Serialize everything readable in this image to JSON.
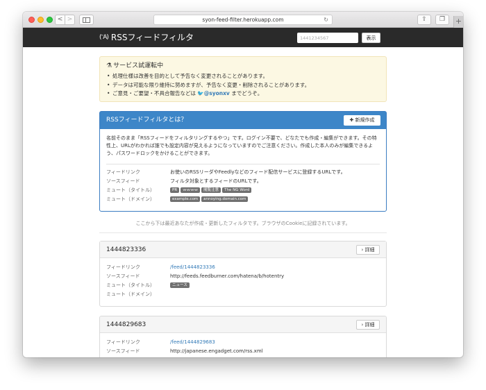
{
  "browser": {
    "url": "syon-feed-filter.herokuapp.com",
    "back_label": "<",
    "forward_label": ">"
  },
  "navbar": {
    "brand": "RSSフィードフィルタ",
    "brand_icon": "(ᵔA)",
    "search_placeholder": "1441234567",
    "show_button": "表示"
  },
  "alert": {
    "title": "サービス試運転中",
    "items": [
      "処理仕様は改善を目的として予告なく変更されることがあります。",
      "データは可能な限り維持に努めますが、予告なく変更・削除されることがあります。"
    ],
    "contact_prefix": "ご意見・ご要望・不具合報告などは ",
    "contact_handle": "@syonxv",
    "contact_suffix": " までどうぞ。"
  },
  "about": {
    "title": "RSSフィードフィルタとは？",
    "new_button": "新規作成",
    "description": "名前そのまま「RSSフィードをフィルタリングするやつ」です。ログイン不要で、どなたでも作成・編集ができます。その特性上、URLがわかれば誰でも設定内容が見えるようになっていますのでご注意ください。作成した本人のみが編集できるよう、パスワードロックをかけることができます。",
    "rows": [
      {
        "label": "フィードリンク",
        "value": "お使いのRSSリーダやFeedlyなどのフィード配信サービスに登録するURLです。"
      },
      {
        "label": "ソースフィード",
        "value": "フィルタ対象とするフィードのURLです。"
      },
      {
        "label": "ミュート（タイトル）",
        "tags": [
          "PR",
          "ｗｗｗｗ",
          "閲覧注意",
          "The NG Word"
        ]
      },
      {
        "label": "ミュート（ドメイン）",
        "tags": [
          "example.com",
          "annoying.domain.com"
        ]
      }
    ]
  },
  "recent_note": "ここから下は最近あなたが作成・更新したフィルタです。ブラウザのCookieに記録されています。",
  "filters": [
    {
      "id": "1444823336",
      "detail_button": "詳細",
      "labels": [
        "フィードリンク",
        "ソースフィード",
        "ミュート（タイトル）",
        "ミュート（ドメイン）"
      ],
      "feed_link": "/feed/1444823336",
      "source_feed": "http://feeds.feedburner.com/hatena/b/hotentry",
      "mute_titles": [
        "ニュース"
      ]
    },
    {
      "id": "1444829683",
      "detail_button": "詳細",
      "labels": [
        "フィードリンク",
        "ソースフィード"
      ],
      "feed_link": "/feed/1444829683",
      "source_feed": "http://japanese.engadget.com/rss.xml"
    }
  ],
  "colors": {
    "navbar": "#2a2a2a",
    "primary": "#3d86c8",
    "alert_bg": "#fcf8e3",
    "link": "#337ab7",
    "tag": "#707070"
  }
}
